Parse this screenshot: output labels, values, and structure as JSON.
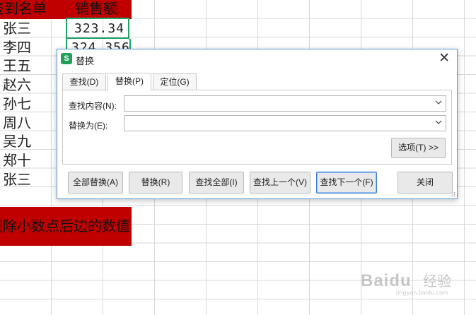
{
  "sheet": {
    "header_name": "签到名单",
    "header_sales": "销售额",
    "names": [
      "张三",
      "李四",
      "王五",
      "赵六",
      "孙七",
      "周八",
      "吴九",
      "郑十",
      "张三"
    ],
    "values_visible": [
      "323.34",
      "324.356"
    ],
    "banner_text": "删除小数点后边的数值"
  },
  "dialog": {
    "title": "替换",
    "app_icon_glyph": "S",
    "tabs": [
      {
        "label": "查找(D)",
        "active": false
      },
      {
        "label": "替换(P)",
        "active": true
      },
      {
        "label": "定位(G)",
        "active": false
      }
    ],
    "find_label": "查找内容(N):",
    "find_value": "",
    "replace_label": "替换为(E):",
    "replace_value": "",
    "options_label": "选项(T) >>",
    "buttons": {
      "replace_all": "全部替换(A)",
      "replace": "替换(R)",
      "find_all": "查找全部(I)",
      "find_prev": "查找上一个(V)",
      "find_next": "查找下一个(F)",
      "close": "关闭"
    }
  },
  "watermark": {
    "brand": "Baidu",
    "sub": "经验",
    "url": "jingyan.baidu.com"
  },
  "colors": {
    "header_red": "#c00000",
    "selection_green": "#21a366",
    "dialog_border": "#5a9bd5",
    "app_icon_green": "#1fa05a"
  }
}
